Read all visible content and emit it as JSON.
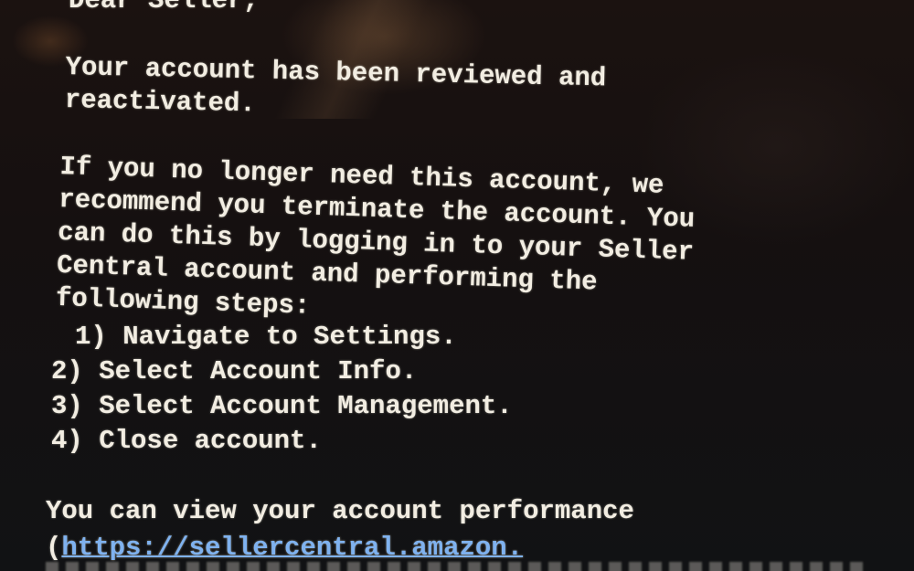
{
  "email": {
    "greeting": "Dear Seller,",
    "paragraph1": [
      "Your account has been reviewed and",
      "reactivated."
    ],
    "paragraph2": [
      "If you no longer need this account, we",
      "recommend you terminate the account. You",
      "can do this by logging in to your Seller",
      "Central account and performing the",
      "following steps:"
    ],
    "steps": [
      "1) Navigate to Settings.",
      "2) Select Account Info.",
      "3) Select Account Management.",
      "4) Close account."
    ],
    "paragraph3": {
      "line1": "You can view your account performance",
      "open_paren": "(",
      "link_text": "https://sellercentral.amazon."
    }
  },
  "colors": {
    "background": "#140d0b",
    "text": "#f2ede2",
    "link": "#7fb2ef"
  }
}
